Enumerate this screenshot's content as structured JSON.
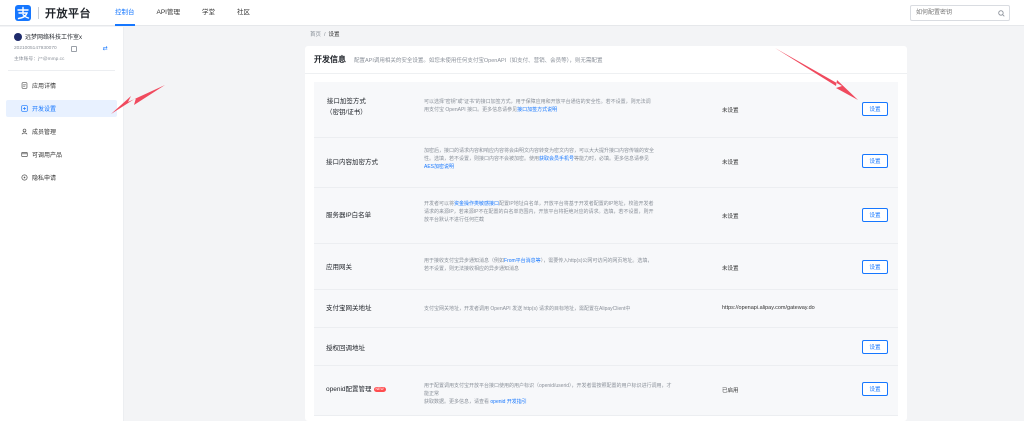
{
  "header": {
    "logo_text": "开放平台",
    "nav": [
      "控制台",
      "API管理",
      "学堂",
      "社区"
    ],
    "search_placeholder": "如何配置密钥"
  },
  "sidebar": {
    "account_name": "远梦网络科技工作室x",
    "account_id": "2021005147930070",
    "account_main": "主体账号：j**@mmp.cc",
    "items": [
      {
        "label": "应用详情",
        "icon": "document-icon",
        "active": false
      },
      {
        "label": "开发设置",
        "icon": "settings-icon",
        "active": true
      },
      {
        "label": "成员管理",
        "icon": "member-icon",
        "active": false
      },
      {
        "label": "可调用产品",
        "icon": "product-icon",
        "active": false
      },
      {
        "label": "隐私申请",
        "icon": "privacy-icon",
        "active": false
      }
    ]
  },
  "breadcrumb": {
    "home": "首页",
    "sep": "/",
    "current": "设置"
  },
  "card": {
    "title": "开发信息",
    "desc": "配置API调用相关的安全设置。如您未使用任何支付宝OpenAPI（如支付、营销、会员等），则无需配置"
  },
  "rows": [
    {
      "name_line1": "接口加签方式",
      "name_line2": "（密钥/证书）",
      "desc_line1": "可以选择“密钥”或“证书”的接口加签方式，用于保障应用和开放平台通信的安全性。若不设置，则无法调",
      "desc_line2": "用支付宝 OpenAPI 接口。更多信息请参见",
      "desc_link": "接口加签方式说明",
      "status": "未设置",
      "button": "设置"
    },
    {
      "name_line1": "接口内容加密方式",
      "desc_line1": "加密后，接口的请求内容和响应内容将会由明文内容转变为密文内容，可以大大提升接口内容传输的安全",
      "desc_line2": "性。选填，若不设置，则接口内容不会被加密。使用",
      "desc_link": "获取会员手机号",
      "desc_after": "等能力时，必填。更多信息请参见",
      "desc_line3_link": "AES加密说明",
      "status": "未设置",
      "button": "设置"
    },
    {
      "name_line1": "服务器IP白名单",
      "desc_line1_pre": "开发者可以将",
      "desc_line1_link": "资金操作类敏感接口",
      "desc_line1_post": "配置IP地址白名单，开放平台将基于开发者配置的IP地址，校验开发者",
      "desc_line2": "请求的来源IP，若来源IP不在配置的白名单范围内，开放平台将拒绝对应的请求。选填，若不设置，则开",
      "desc_line3": "放平台默认不进行任何拦截",
      "status": "未设置",
      "button": "设置"
    },
    {
      "name_line1": "应用网关",
      "desc_line1_pre": "用于接收支付宝异步通知消息（例如",
      "desc_line1_link": "From平台消息等",
      "desc_line1_post": "），需要传入http(s)公网可访问的网页地址。选填，",
      "desc_line2": "若不设置，则无法接收相应的异步通知消息",
      "status": "未设置",
      "button": "设置"
    },
    {
      "name_line1": "支付宝网关地址",
      "desc_line1": "支付宝网关地址，开发者调用 OpenAPI 发送 http(s) 请求的目标地址，需配置在AlipayClient中",
      "status": "https://openapi.alipay.com/gateway.do",
      "button": ""
    },
    {
      "name_line1": "授权回调地址",
      "desc_line1": "",
      "status": "",
      "button": "设置"
    },
    {
      "name_line1": "openid配置管理",
      "badge": "NEW",
      "desc_line1": "用于配置调用支付宝开放平台接口使用的用户标识（openid/userid），开发者需按照配置的用户标识进行调用，才能正常",
      "desc_line2_pre": "获取数据。更多信息，请查看 ",
      "desc_line2_link": "openid 开发指引",
      "status": "已启用",
      "button": "设置"
    }
  ],
  "colors": {
    "accent": "#1677ff",
    "arrow": "#f04a5e"
  }
}
